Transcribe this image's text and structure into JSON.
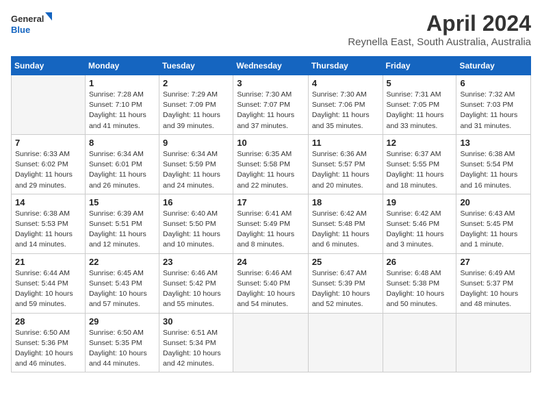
{
  "header": {
    "logo_general": "General",
    "logo_blue": "Blue",
    "title": "April 2024",
    "subtitle": "Reynella East, South Australia, Australia"
  },
  "calendar": {
    "days_of_week": [
      "Sunday",
      "Monday",
      "Tuesday",
      "Wednesday",
      "Thursday",
      "Friday",
      "Saturday"
    ],
    "weeks": [
      [
        {
          "date": "",
          "sunrise": "",
          "sunset": "",
          "daylight": ""
        },
        {
          "date": "1",
          "sunrise": "Sunrise: 7:28 AM",
          "sunset": "Sunset: 7:10 PM",
          "daylight": "Daylight: 11 hours and 41 minutes."
        },
        {
          "date": "2",
          "sunrise": "Sunrise: 7:29 AM",
          "sunset": "Sunset: 7:09 PM",
          "daylight": "Daylight: 11 hours and 39 minutes."
        },
        {
          "date": "3",
          "sunrise": "Sunrise: 7:30 AM",
          "sunset": "Sunset: 7:07 PM",
          "daylight": "Daylight: 11 hours and 37 minutes."
        },
        {
          "date": "4",
          "sunrise": "Sunrise: 7:30 AM",
          "sunset": "Sunset: 7:06 PM",
          "daylight": "Daylight: 11 hours and 35 minutes."
        },
        {
          "date": "5",
          "sunrise": "Sunrise: 7:31 AM",
          "sunset": "Sunset: 7:05 PM",
          "daylight": "Daylight: 11 hours and 33 minutes."
        },
        {
          "date": "6",
          "sunrise": "Sunrise: 7:32 AM",
          "sunset": "Sunset: 7:03 PM",
          "daylight": "Daylight: 11 hours and 31 minutes."
        }
      ],
      [
        {
          "date": "7",
          "sunrise": "Sunrise: 6:33 AM",
          "sunset": "Sunset: 6:02 PM",
          "daylight": "Daylight: 11 hours and 29 minutes."
        },
        {
          "date": "8",
          "sunrise": "Sunrise: 6:34 AM",
          "sunset": "Sunset: 6:01 PM",
          "daylight": "Daylight: 11 hours and 26 minutes."
        },
        {
          "date": "9",
          "sunrise": "Sunrise: 6:34 AM",
          "sunset": "Sunset: 5:59 PM",
          "daylight": "Daylight: 11 hours and 24 minutes."
        },
        {
          "date": "10",
          "sunrise": "Sunrise: 6:35 AM",
          "sunset": "Sunset: 5:58 PM",
          "daylight": "Daylight: 11 hours and 22 minutes."
        },
        {
          "date": "11",
          "sunrise": "Sunrise: 6:36 AM",
          "sunset": "Sunset: 5:57 PM",
          "daylight": "Daylight: 11 hours and 20 minutes."
        },
        {
          "date": "12",
          "sunrise": "Sunrise: 6:37 AM",
          "sunset": "Sunset: 5:55 PM",
          "daylight": "Daylight: 11 hours and 18 minutes."
        },
        {
          "date": "13",
          "sunrise": "Sunrise: 6:38 AM",
          "sunset": "Sunset: 5:54 PM",
          "daylight": "Daylight: 11 hours and 16 minutes."
        }
      ],
      [
        {
          "date": "14",
          "sunrise": "Sunrise: 6:38 AM",
          "sunset": "Sunset: 5:53 PM",
          "daylight": "Daylight: 11 hours and 14 minutes."
        },
        {
          "date": "15",
          "sunrise": "Sunrise: 6:39 AM",
          "sunset": "Sunset: 5:51 PM",
          "daylight": "Daylight: 11 hours and 12 minutes."
        },
        {
          "date": "16",
          "sunrise": "Sunrise: 6:40 AM",
          "sunset": "Sunset: 5:50 PM",
          "daylight": "Daylight: 11 hours and 10 minutes."
        },
        {
          "date": "17",
          "sunrise": "Sunrise: 6:41 AM",
          "sunset": "Sunset: 5:49 PM",
          "daylight": "Daylight: 11 hours and 8 minutes."
        },
        {
          "date": "18",
          "sunrise": "Sunrise: 6:42 AM",
          "sunset": "Sunset: 5:48 PM",
          "daylight": "Daylight: 11 hours and 6 minutes."
        },
        {
          "date": "19",
          "sunrise": "Sunrise: 6:42 AM",
          "sunset": "Sunset: 5:46 PM",
          "daylight": "Daylight: 11 hours and 3 minutes."
        },
        {
          "date": "20",
          "sunrise": "Sunrise: 6:43 AM",
          "sunset": "Sunset: 5:45 PM",
          "daylight": "Daylight: 11 hours and 1 minute."
        }
      ],
      [
        {
          "date": "21",
          "sunrise": "Sunrise: 6:44 AM",
          "sunset": "Sunset: 5:44 PM",
          "daylight": "Daylight: 10 hours and 59 minutes."
        },
        {
          "date": "22",
          "sunrise": "Sunrise: 6:45 AM",
          "sunset": "Sunset: 5:43 PM",
          "daylight": "Daylight: 10 hours and 57 minutes."
        },
        {
          "date": "23",
          "sunrise": "Sunrise: 6:46 AM",
          "sunset": "Sunset: 5:42 PM",
          "daylight": "Daylight: 10 hours and 55 minutes."
        },
        {
          "date": "24",
          "sunrise": "Sunrise: 6:46 AM",
          "sunset": "Sunset: 5:40 PM",
          "daylight": "Daylight: 10 hours and 54 minutes."
        },
        {
          "date": "25",
          "sunrise": "Sunrise: 6:47 AM",
          "sunset": "Sunset: 5:39 PM",
          "daylight": "Daylight: 10 hours and 52 minutes."
        },
        {
          "date": "26",
          "sunrise": "Sunrise: 6:48 AM",
          "sunset": "Sunset: 5:38 PM",
          "daylight": "Daylight: 10 hours and 50 minutes."
        },
        {
          "date": "27",
          "sunrise": "Sunrise: 6:49 AM",
          "sunset": "Sunset: 5:37 PM",
          "daylight": "Daylight: 10 hours and 48 minutes."
        }
      ],
      [
        {
          "date": "28",
          "sunrise": "Sunrise: 6:50 AM",
          "sunset": "Sunset: 5:36 PM",
          "daylight": "Daylight: 10 hours and 46 minutes."
        },
        {
          "date": "29",
          "sunrise": "Sunrise: 6:50 AM",
          "sunset": "Sunset: 5:35 PM",
          "daylight": "Daylight: 10 hours and 44 minutes."
        },
        {
          "date": "30",
          "sunrise": "Sunrise: 6:51 AM",
          "sunset": "Sunset: 5:34 PM",
          "daylight": "Daylight: 10 hours and 42 minutes."
        },
        {
          "date": "",
          "sunrise": "",
          "sunset": "",
          "daylight": ""
        },
        {
          "date": "",
          "sunrise": "",
          "sunset": "",
          "daylight": ""
        },
        {
          "date": "",
          "sunrise": "",
          "sunset": "",
          "daylight": ""
        },
        {
          "date": "",
          "sunrise": "",
          "sunset": "",
          "daylight": ""
        }
      ]
    ]
  }
}
